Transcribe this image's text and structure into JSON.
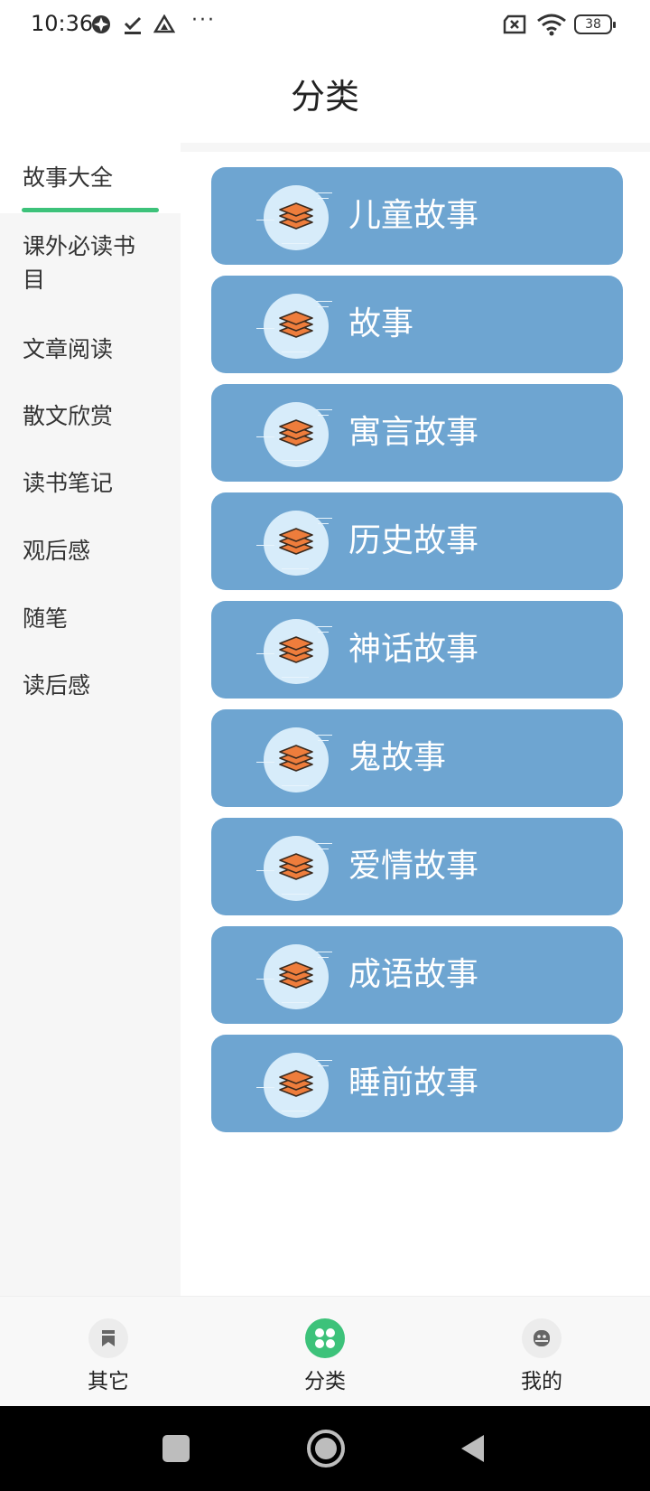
{
  "status_bar": {
    "time": "10:36",
    "icons": [
      "sync-icon",
      "download-done-icon",
      "drive-icon",
      "more-icon"
    ],
    "more": "···",
    "right_icons": [
      "no-sim-icon",
      "wifi-icon",
      "battery-icon"
    ],
    "battery": "38"
  },
  "header": {
    "title": "分类"
  },
  "sidebar": {
    "items": [
      {
        "label": "故事大全",
        "active": true
      },
      {
        "label": "课外必读书目"
      },
      {
        "label": "文章阅读"
      },
      {
        "label": "散文欣赏"
      },
      {
        "label": "读书笔记"
      },
      {
        "label": "观后感"
      },
      {
        "label": "随笔"
      },
      {
        "label": "读后感"
      }
    ],
    "accent": "#3dc27a"
  },
  "categories": [
    {
      "label": "儿童故事",
      "icon": "layers-icon"
    },
    {
      "label": "故事",
      "icon": "layers-icon"
    },
    {
      "label": "寓言故事",
      "icon": "layers-icon"
    },
    {
      "label": "历史故事",
      "icon": "layers-icon"
    },
    {
      "label": "神话故事",
      "icon": "layers-icon"
    },
    {
      "label": "鬼故事",
      "icon": "layers-icon"
    },
    {
      "label": "爱情故事",
      "icon": "layers-icon"
    },
    {
      "label": "成语故事",
      "icon": "layers-icon"
    },
    {
      "label": "睡前故事",
      "icon": "layers-icon"
    }
  ],
  "card_color": "#6ea5d1",
  "icon_color": "#ee7d3c",
  "bottom_nav": [
    {
      "label": "其它",
      "icon": "bookmark-icon",
      "active": false
    },
    {
      "label": "分类",
      "icon": "grid-icon",
      "active": true
    },
    {
      "label": "我的",
      "icon": "profile-icon",
      "active": false
    }
  ],
  "system_nav": [
    "recent-apps-button",
    "home-button",
    "back-button"
  ]
}
